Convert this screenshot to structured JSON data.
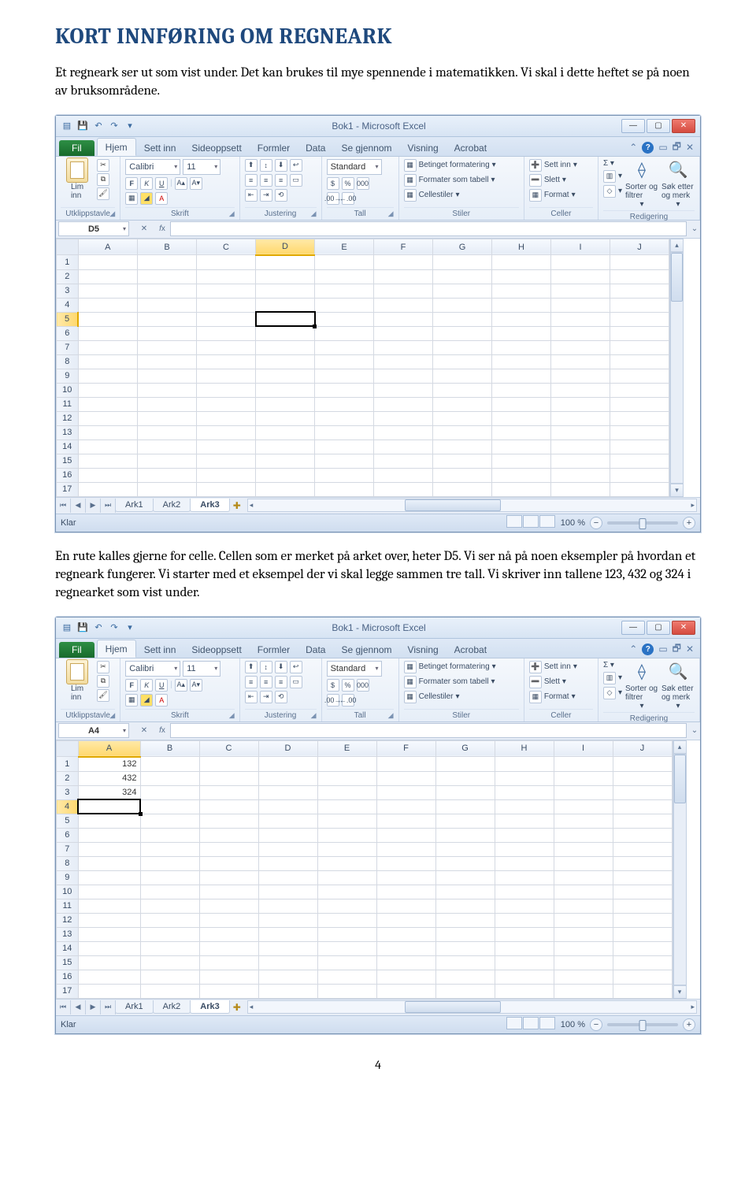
{
  "doc": {
    "heading": "KORT INNFØRING OM REGNEARK",
    "para1": "Et regneark ser ut som vist under. Det kan brukes til mye spennende i matematikken. Vi skal i dette heftet se på noen av bruksområdene.",
    "para2": "En rute kalles gjerne for celle. Cellen som er merket på arket over, heter D5. Vi ser nå på noen eksempler på hvordan et regneark fungerer. Vi starter med et eksempel der vi skal legge sammen tre tall. Vi skriver inn tallene 123, 432 og 324 i regnearket som vist under.",
    "pagenum": "4"
  },
  "excel": {
    "title": "Bok1  -  Microsoft Excel",
    "tabs": {
      "file": "Fil",
      "hjem": "Hjem",
      "settinn": "Sett inn",
      "sideoppsett": "Sideoppsett",
      "formler": "Formler",
      "data": "Data",
      "segjennom": "Se gjennom",
      "visning": "Visning",
      "acrobat": "Acrobat"
    },
    "ribbon": {
      "clipboard": {
        "label": "Utklippstavle",
        "paste": "Lim\ninn"
      },
      "font": {
        "label": "Skrift",
        "name": "Calibri",
        "size": "11"
      },
      "align": {
        "label": "Justering"
      },
      "number": {
        "label": "Tall",
        "fmt": "Standard",
        "pct": "%",
        "thou": "000"
      },
      "styles": {
        "label": "Stiler",
        "cond": "Betinget formatering",
        "astable": "Formater som tabell",
        "cellst": "Cellestiler"
      },
      "cells": {
        "label": "Celler",
        "insert": "Sett inn",
        "delete": "Slett",
        "format": "Format"
      },
      "edit": {
        "label": "Redigering",
        "sort": "Sorter og filtrer",
        "find1": "Søk etter og merk",
        "find2": "Søk etter"
      }
    },
    "cols": [
      "A",
      "B",
      "C",
      "D",
      "E",
      "F",
      "G",
      "H",
      "I",
      "J"
    ],
    "rows": [
      "1",
      "2",
      "3",
      "4",
      "5",
      "6",
      "7",
      "8",
      "9",
      "10",
      "11",
      "12",
      "13",
      "14",
      "15",
      "16",
      "17"
    ],
    "sheets": {
      "s1": "Ark1",
      "s2": "Ark2",
      "s3": "Ark3"
    },
    "status": {
      "ready": "Klar",
      "zoom": "100 %"
    }
  },
  "shot1": {
    "namebox": "D5",
    "activeRow": "5",
    "activeCol": "D",
    "findlabel": "Søk etter og merk"
  },
  "shot2": {
    "namebox": "A4",
    "activeRow": "4",
    "activeCol": "A",
    "findlabel": "Søk etter og merk",
    "cells": {
      "A1": "132",
      "A2": "432",
      "A3": "324"
    }
  }
}
